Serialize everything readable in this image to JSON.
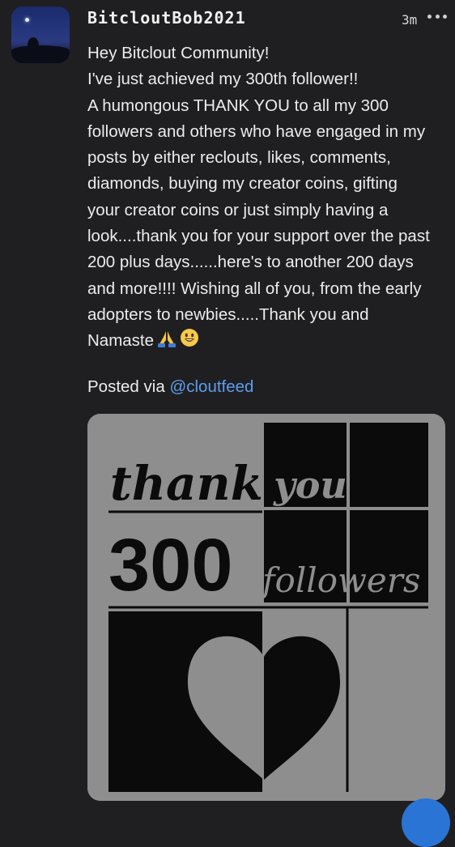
{
  "post": {
    "username": "BitcloutBob2021",
    "time": "3m",
    "lines": [
      "Hey Bitclout Community!",
      "I've just achieved my 300th follower!!",
      "A humongous THANK YOU to all my 300",
      "followers and others who have engaged in my",
      "posts by either reclouts, likes, comments,",
      "diamonds, buying my creator coins, gifting",
      "your creator coins or just simply having a",
      "look....thank you for your support over the past",
      "200 plus days......here's to another 200 days",
      "and more!!!! Wishing all of you, from the early",
      "adopters to newbies.....Thank you and",
      "Namaste"
    ],
    "posted_via_label": "Posted via",
    "posted_via_link": "@cloutfeed"
  },
  "image": {
    "words": [
      "thank",
      "you",
      "300",
      "followers"
    ]
  },
  "icons": {
    "more": "more-options-icon",
    "pray": "folded-hands-emoji",
    "smile": "smiling-face-emoji"
  },
  "colors": {
    "background": "#1f1f21",
    "text": "#ececec",
    "link": "#5c9ded",
    "accent_button": "#2a74d6"
  }
}
